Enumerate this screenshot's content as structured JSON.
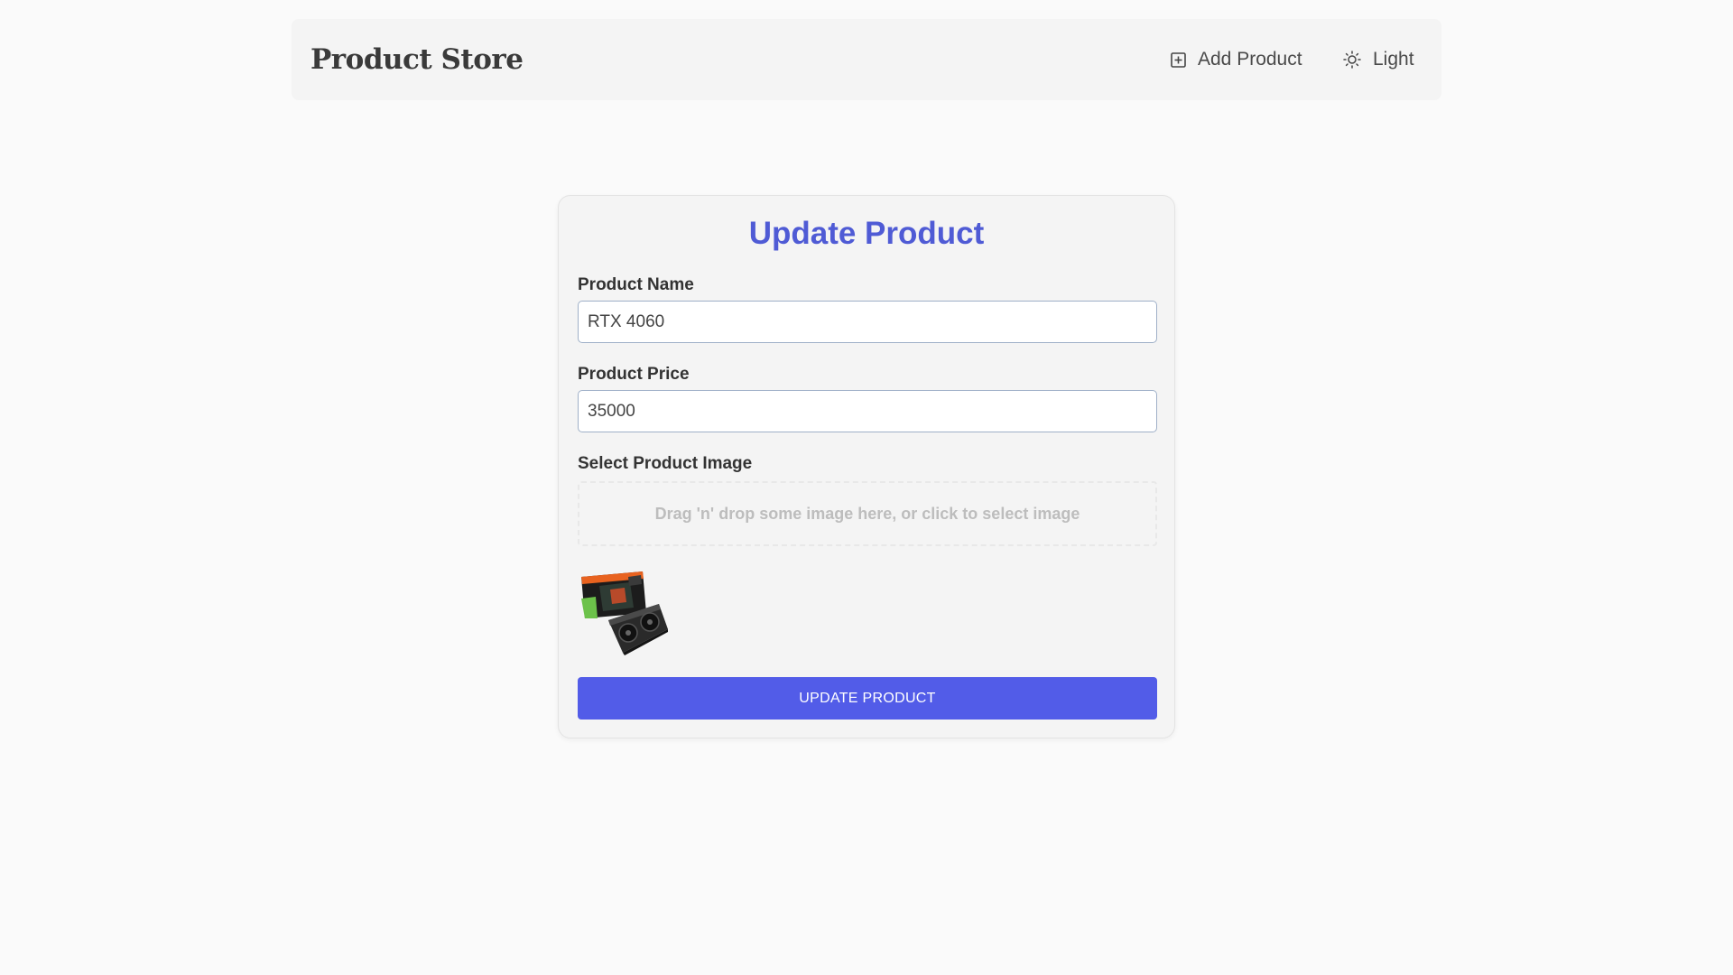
{
  "navbar": {
    "brand": "Product Store",
    "add_product_label": "Add Product",
    "add_product_icon": "plus-square-icon",
    "theme_label": "Light",
    "theme_icon": "sun-icon"
  },
  "form": {
    "title": "Update Product",
    "name_label": "Product Name",
    "name_value": "RTX 4060",
    "price_label": "Product Price",
    "price_value": "35000",
    "image_label": "Select Product Image",
    "dropzone_text": "Drag 'n' drop some image here, or click to select image",
    "preview_icon": "graphics-card-product-image",
    "submit_label": "UPDATE PRODUCT"
  },
  "colors": {
    "accent": "#525ce8",
    "title": "#4f5bd5",
    "background": "#fafafa",
    "surface": "#f4f4f4"
  }
}
